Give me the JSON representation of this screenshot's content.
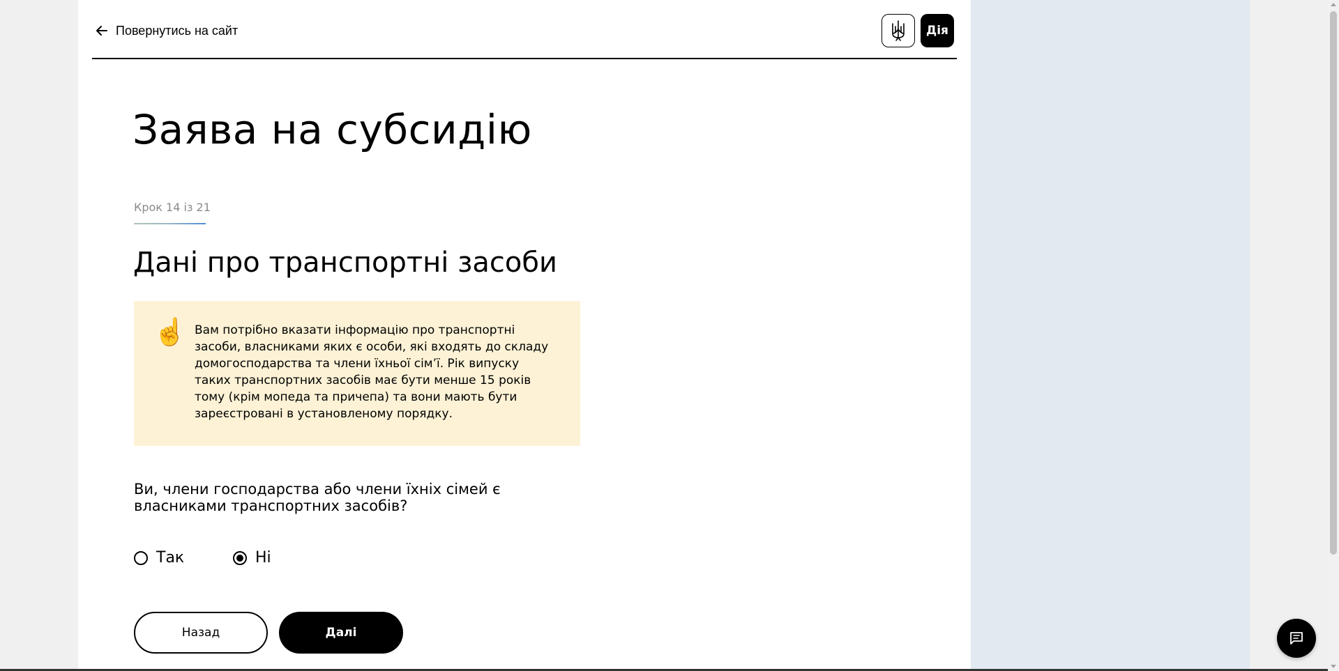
{
  "header": {
    "back_label": "Повернутись на сайт",
    "logo_text": "Дія"
  },
  "page": {
    "title": "Заява на субсидію",
    "step": "Крок 14 із 21",
    "section_title": "Дані про транспортні засоби"
  },
  "info": {
    "emoji": "☝️",
    "text": "Вам потрібно вказати інформацію про транспортні засоби, власниками яких є особи, які входять до складу домогосподарства та члени їхньої сім’ї. Рік випуску таких транспортних засобів має бути менше 15 років тому (крім мопеда та причепа) та вони мають бути зареєстровані в установленому порядку."
  },
  "question": {
    "text": "Ви, члени господарства або члени їхніх сімей є власниками транспортних засобів?",
    "options": [
      {
        "label": "Так",
        "selected": false
      },
      {
        "label": "Ні",
        "selected": true
      }
    ]
  },
  "buttons": {
    "back_label": "Назад",
    "next_label": "Далі"
  },
  "colors": {
    "info_background": "#fdf2d6",
    "side_panel": "#e2e9f1",
    "primary": "#000000"
  }
}
